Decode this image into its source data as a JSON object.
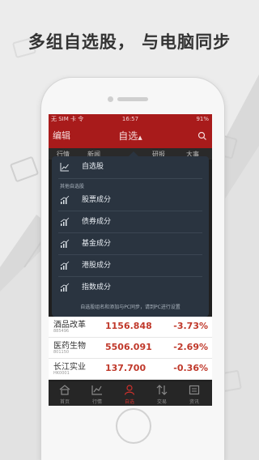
{
  "headline": "多组自选股， 与电脑同步",
  "status_bar": {
    "carrier": "无 SIM 卡 令",
    "time": "16:57",
    "battery": "91%"
  },
  "nav": {
    "edit_label": "编辑",
    "title": "自选",
    "caret": "▲",
    "search_icon": "search-icon"
  },
  "tabs": [
    "行情",
    "新闻",
    "",
    "研报",
    "大事"
  ],
  "dropdown": {
    "top_item": {
      "label": "自选股",
      "icon": "line-chart-icon"
    },
    "section_label": "其他自选股",
    "items": [
      {
        "label": "股票成分",
        "icon": "bar-chart-icon"
      },
      {
        "label": "债券成分",
        "icon": "bar-chart-icon"
      },
      {
        "label": "基金成分",
        "icon": "bar-chart-icon"
      },
      {
        "label": "港股成分",
        "icon": "bar-chart-icon"
      },
      {
        "label": "指数成分",
        "icon": "bar-chart-icon"
      }
    ],
    "footer": "自选股组名和添加与PC同步，请到PC进行设置"
  },
  "stocks": [
    {
      "name": "酒品改革",
      "code": "885496",
      "price": "1156.848",
      "change": "-3.73%"
    },
    {
      "name": "医药生物",
      "code": "801150",
      "price": "5506.091",
      "change": "-2.69%"
    },
    {
      "name": "长江实业",
      "code": "HK0001",
      "price": "137.700",
      "change": "-0.36%"
    }
  ],
  "tabbar": [
    {
      "label": "首页",
      "icon": "home-icon",
      "active": false
    },
    {
      "label": "行情",
      "icon": "chart-icon",
      "active": false
    },
    {
      "label": "自选",
      "icon": "person-icon",
      "active": true
    },
    {
      "label": "交易",
      "icon": "transfer-icon",
      "active": false
    },
    {
      "label": "资讯",
      "icon": "news-icon",
      "active": false
    }
  ],
  "colors": {
    "brand_red": "#a81b1b",
    "down_red": "#c0392b",
    "menu_bg": "#2a3440"
  }
}
